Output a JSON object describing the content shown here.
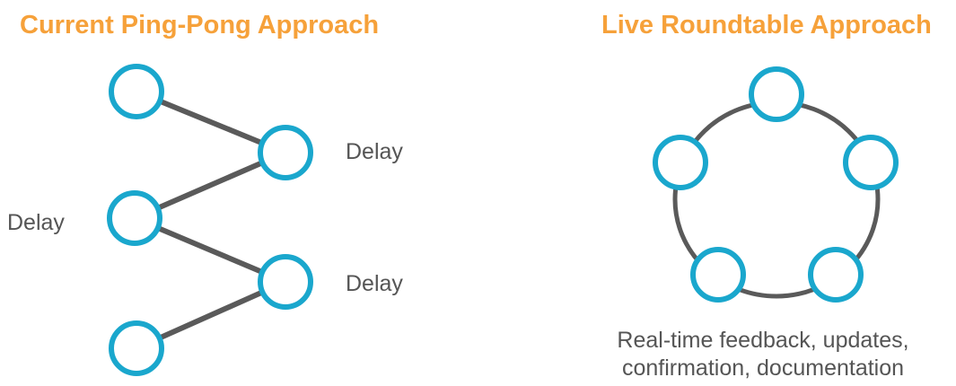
{
  "left_panel": {
    "title": "Current Ping-Pong Approach",
    "delay_labels": [
      "Delay",
      "Delay",
      "Delay"
    ]
  },
  "right_panel": {
    "title": "Live Roundtable Approach",
    "caption_lines": [
      "Real-time feedback, updates,",
      "confirmation, documentation"
    ]
  },
  "colors": {
    "title": "#f6a13a",
    "node_stroke": "#1aa7cd",
    "connector": "#5a5a5a",
    "text": "#555555"
  }
}
